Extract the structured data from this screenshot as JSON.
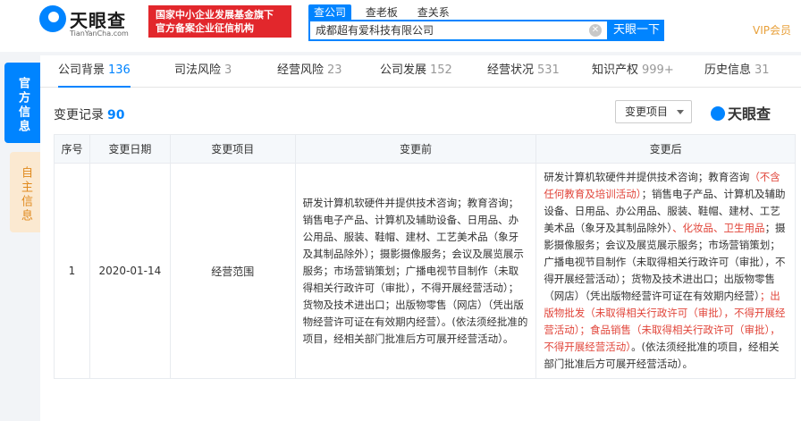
{
  "header": {
    "logo_text": "天眼查",
    "logo_sub": "TianYanCha.com",
    "banner_line1": "国家中小企业发展基金旗下",
    "banner_line2": "官方备案企业征信机构",
    "search_tabs": [
      "查公司",
      "查老板",
      "查关系"
    ],
    "search_value": "成都超有爱科技有限公司",
    "search_button": "天眼一下",
    "vip_label": "VIP会员"
  },
  "sidebar": {
    "tab_official": "官方信息",
    "tab_self": "自主信息"
  },
  "nav": [
    {
      "label": "公司背景",
      "count": "136"
    },
    {
      "label": "司法风险",
      "count": "3"
    },
    {
      "label": "经营风险",
      "count": "23"
    },
    {
      "label": "公司发展",
      "count": "152"
    },
    {
      "label": "经营状况",
      "count": "531"
    },
    {
      "label": "知识产权",
      "count": "999+"
    },
    {
      "label": "历史信息",
      "count": "31"
    }
  ],
  "section": {
    "title": "变更记录",
    "count": "90",
    "filter_label": "变更项目",
    "watermark": "天眼查"
  },
  "table": {
    "headers": [
      "序号",
      "变更日期",
      "变更项目",
      "变更前",
      "变更后"
    ],
    "row": {
      "index": "1",
      "date": "2020-01-14",
      "item": "经营范围",
      "before": "研发计算机软硬件并提供技术咨询；教育咨询；销售电子产品、计算机及辅助设备、日用品、办公用品、服装、鞋帽、建材、工艺美术品（象牙及其制品除外）；摄影摄像服务；会议及展览展示服务；市场营销策划；广播电视节目制作（未取得相关行政许可（审批），不得开展经营活动）；货物及技术进出口；出版物零售（网店）（凭出版物经营许可证在有效期内经营）。(依法须经批准的项目，经相关部门批准后方可展开经营活动）。",
      "after_parts": [
        {
          "text": "研发计算机软硬件并提供技术咨询；教育咨询",
          "hl": false
        },
        {
          "text": "（不含任何教育及培训活动）",
          "hl": true
        },
        {
          "text": "；销售电子产品、计算机及辅助设备、日用品、办公用品、服装、鞋帽、建材、工艺美术品（象牙及其制品除外）",
          "hl": false
        },
        {
          "text": "、化妆品、卫生用品",
          "hl": true
        },
        {
          "text": "；摄影摄像服务；会议及展览展示服务；市场营销策划；广播电视节目制作（未取得相关行政许可（审批），不得开展经营活动）；货物及技术进出口；出版物零售（网店）（凭出版物经营许可证在有效期内经营）",
          "hl": false
        },
        {
          "text": "；出版物批发（未取得相关行政许可（审批），不得开展经营活动）；食品销售（未取得相关行政许可（审批），不得开展经营活动）",
          "hl": true
        },
        {
          "text": "。(依法须经批准的项目，经相关部门批准后方可展开经营活动）。",
          "hl": false
        }
      ]
    }
  },
  "colors": {
    "accent": "#0084ff",
    "highlight": "#e1453a",
    "banner": "#e2272c",
    "vip": "#e8a03a"
  }
}
